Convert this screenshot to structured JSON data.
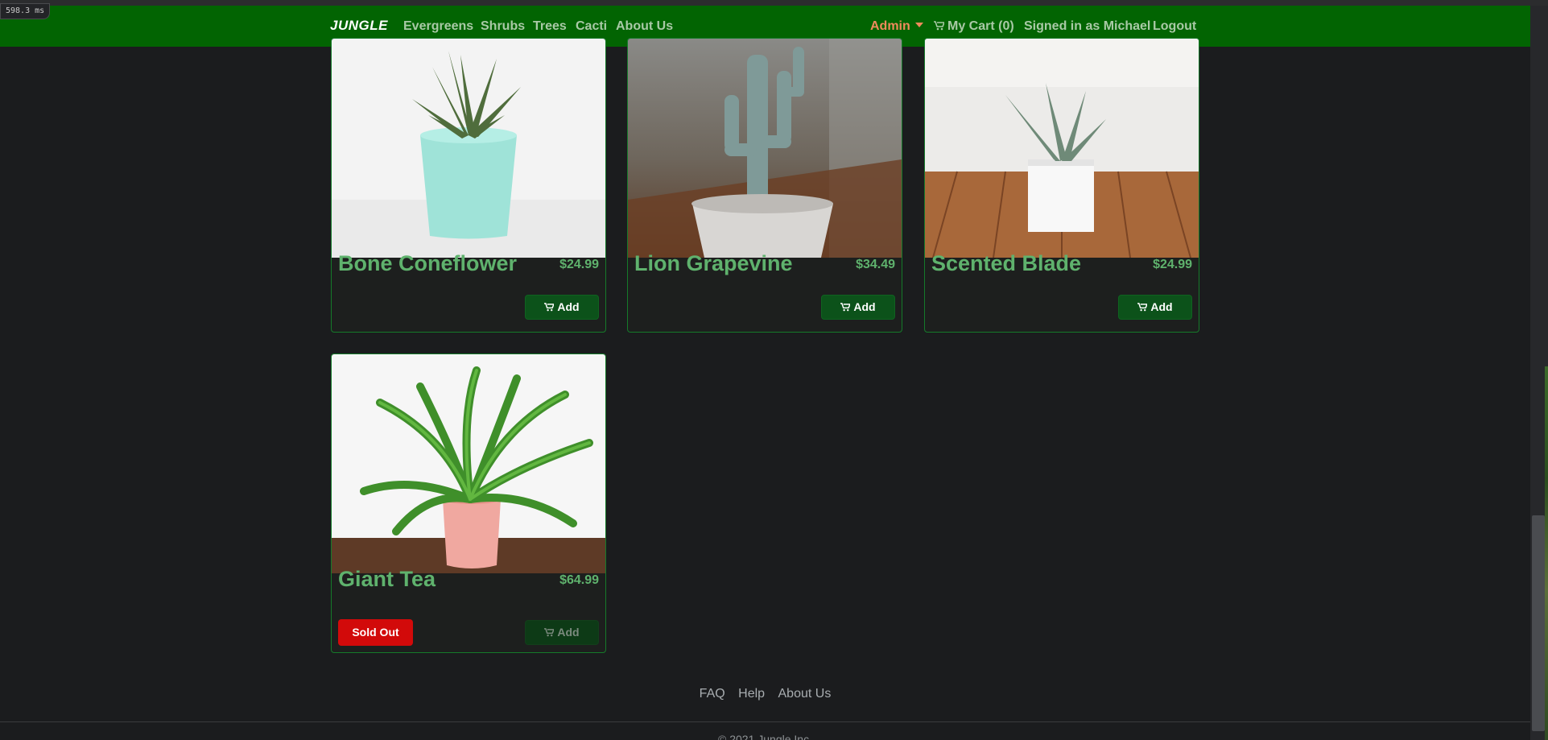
{
  "timer": {
    "text": "598.3 ms"
  },
  "nav": {
    "brand": "JUNGLE",
    "categories": [
      "Evergreens",
      "Shrubs",
      "Trees",
      "Cacti",
      "About Us"
    ],
    "admin_label": "Admin",
    "cart_label": "My Cart (0)",
    "signed_in": "Signed in as Michael",
    "logout": "Logout",
    "colors": {
      "navbar": "#026402",
      "admin": "#f08a5c"
    }
  },
  "products": [
    {
      "name": "Bone Coneflower",
      "price": "$24.99",
      "add_label": "Add",
      "image_icon": "succulent-in-mint-pot-image"
    },
    {
      "name": "Lion Grapevine",
      "price": "$34.49",
      "add_label": "Add",
      "image_icon": "cactus-in-white-pot-image"
    },
    {
      "name": "Scented Blade",
      "price": "$24.99",
      "add_label": "Add",
      "image_icon": "succulent-in-white-square-pot-image"
    },
    {
      "name": "Giant Tea",
      "price": "$64.99",
      "add_label": "Add",
      "sold_out_label": "Sold Out",
      "image_icon": "fern-in-pink-pot-image"
    }
  ],
  "footer": {
    "links": [
      "FAQ",
      "Help",
      "About Us"
    ],
    "copyright": "© 2021 Jungle Inc."
  },
  "accent": {
    "product_text": "#5fb26d",
    "sold_out": "#d20a0a",
    "add_button": "#0c521a"
  }
}
